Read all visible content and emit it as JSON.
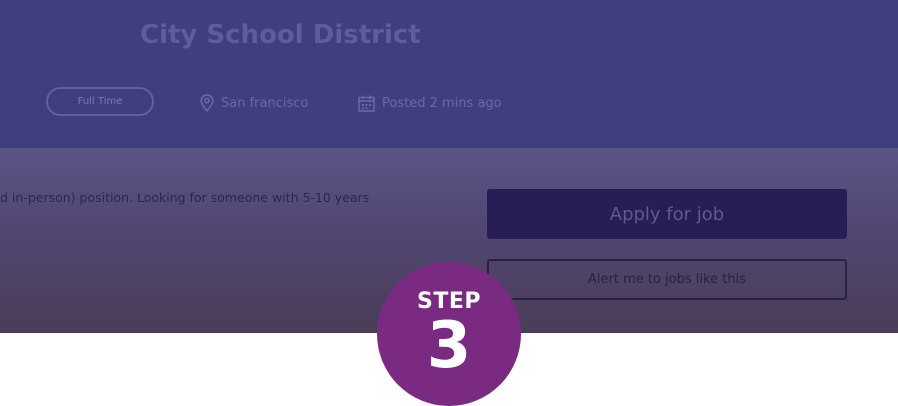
{
  "header": {
    "company": "City School District",
    "job_type": "Full Time",
    "location": "San francisco",
    "posted": "Posted 2 mins ago",
    "icons": {
      "location": "map-pin-icon",
      "posted": "calendar-icon"
    }
  },
  "content": {
    "description": "d in-person) position. Looking for someone with 5-10 years",
    "apply_label": "Apply for job",
    "alert_label": "Alert me to jobs like this"
  },
  "badge": {
    "word": "STEP",
    "number": "3"
  },
  "colors": {
    "header_bg": "#413e80",
    "apply_bg": "#261e55",
    "badge_bg": "#7b2a82"
  }
}
